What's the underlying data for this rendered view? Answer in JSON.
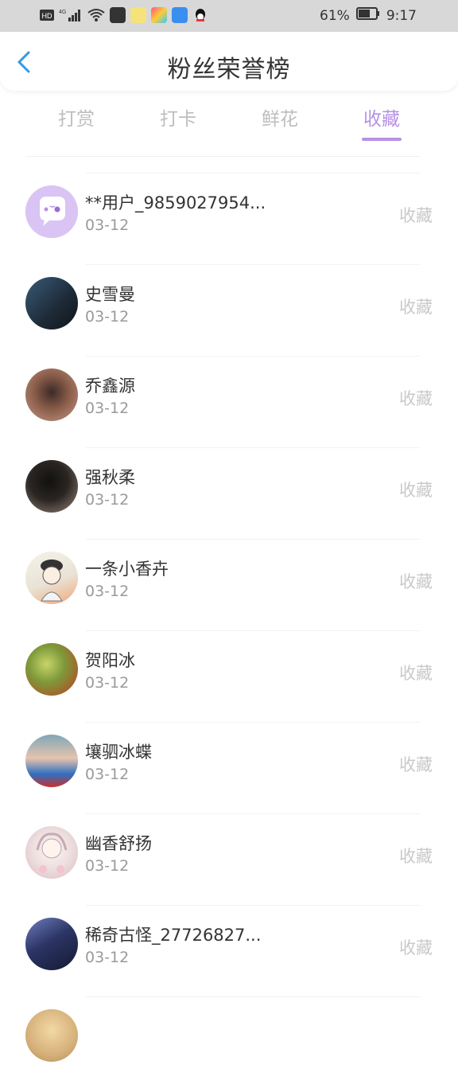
{
  "status_bar": {
    "left_labels": [
      "HD",
      "4G"
    ],
    "battery": "61%",
    "time": "9:17"
  },
  "header": {
    "title": "粉丝荣誉榜"
  },
  "tabs": [
    {
      "label": "打赏",
      "active": false
    },
    {
      "label": "打卡",
      "active": false
    },
    {
      "label": "鲜花",
      "active": false
    },
    {
      "label": "收藏",
      "active": true
    }
  ],
  "colors": {
    "accent": "#b791e6",
    "inactive_tab": "#bdbdbd",
    "back_arrow": "#2f9ae6"
  },
  "fans": [
    {
      "name": "**用户_9859027954...",
      "date": "03-12",
      "action": "收藏"
    },
    {
      "name": "史雪曼",
      "date": "03-12",
      "action": "收藏"
    },
    {
      "name": "乔鑫源",
      "date": "03-12",
      "action": "收藏"
    },
    {
      "name": "强秋柔",
      "date": "03-12",
      "action": "收藏"
    },
    {
      "name": "一条小香卉",
      "date": "03-12",
      "action": "收藏"
    },
    {
      "name": "贺阳冰",
      "date": "03-12",
      "action": "收藏"
    },
    {
      "name": "壤驷冰蝶",
      "date": "03-12",
      "action": "收藏"
    },
    {
      "name": "幽香舒扬",
      "date": "03-12",
      "action": "收藏"
    },
    {
      "name": "稀奇古怪_27726827...",
      "date": "03-12",
      "action": "收藏"
    }
  ]
}
